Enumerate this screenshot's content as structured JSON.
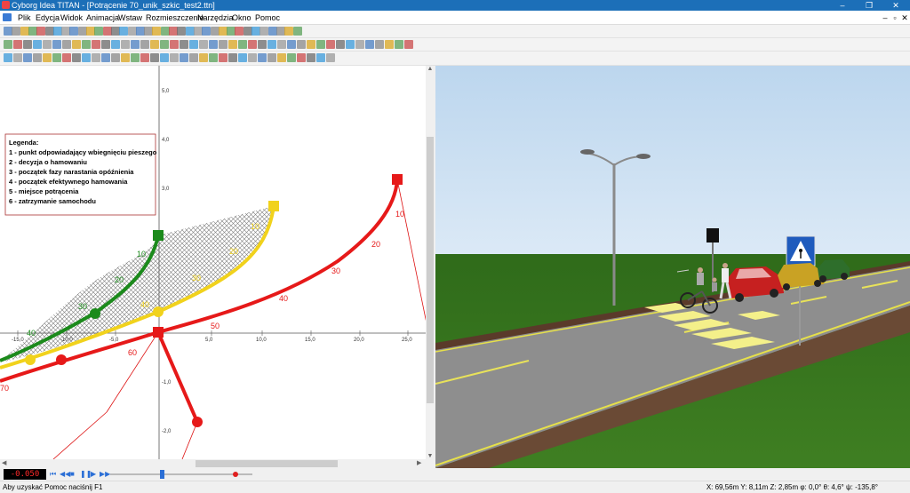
{
  "window": {
    "title": "Cyborg Idea TITAN - [Potrącenie 70_unik_szkic_test2.ttn]",
    "buttons": {
      "minimize": "–",
      "restore": "❐",
      "close": "✕"
    }
  },
  "menu": {
    "items": [
      "Plik",
      "Edycja",
      "Widok",
      "Animacja",
      "Wstaw",
      "Rozmieszczenie",
      "Narzędzia",
      "Okno",
      "Pomoc"
    ],
    "mdi": {
      "minimize": "–",
      "restore": "▫",
      "close": "✕"
    }
  },
  "legend": {
    "title": "Legenda:",
    "items": [
      "1 - punkt odpowiadający wbiegnięciu pieszego",
      "2 - decyzja o hamowaniu",
      "3 - początek fazy narastania opóźnienia",
      "4 - początek efektywnego hamowania",
      "5 - miejsce potrącenia",
      "6 - zatrzymanie samochodu"
    ]
  },
  "axes": {
    "x_ticks": [
      "-15,0",
      "-10,0",
      "-5,0",
      "5,0",
      "10,0",
      "15,0",
      "20,0",
      "25,0"
    ],
    "y_ticks": [
      "5,0",
      "4,0",
      "3,0",
      "-1,0",
      "-2,0"
    ]
  },
  "path_labels": {
    "green": [
      "10",
      "20",
      "30",
      "40"
    ],
    "yellow": [
      "10",
      "20",
      "30",
      "40"
    ],
    "red": [
      "10",
      "20",
      "30",
      "40",
      "50",
      "60",
      "70"
    ]
  },
  "colors": {
    "green": "#1b8a1b",
    "yellow": "#f1d21c",
    "red": "#e61919",
    "titlebar": "#1c6fb8"
  },
  "animation": {
    "time": "-0.050",
    "controls": [
      "⏮",
      "◀◀",
      "■",
      "❚❚",
      "▶",
      "▶▶"
    ]
  },
  "status": {
    "help": "Aby uzyskać Pomoc naciśnij F1",
    "coords": "X: 69,56m Y: 8,11m Z: 2,85m φ: 0,0° θ: 4,6° ψ: -135,8°"
  }
}
